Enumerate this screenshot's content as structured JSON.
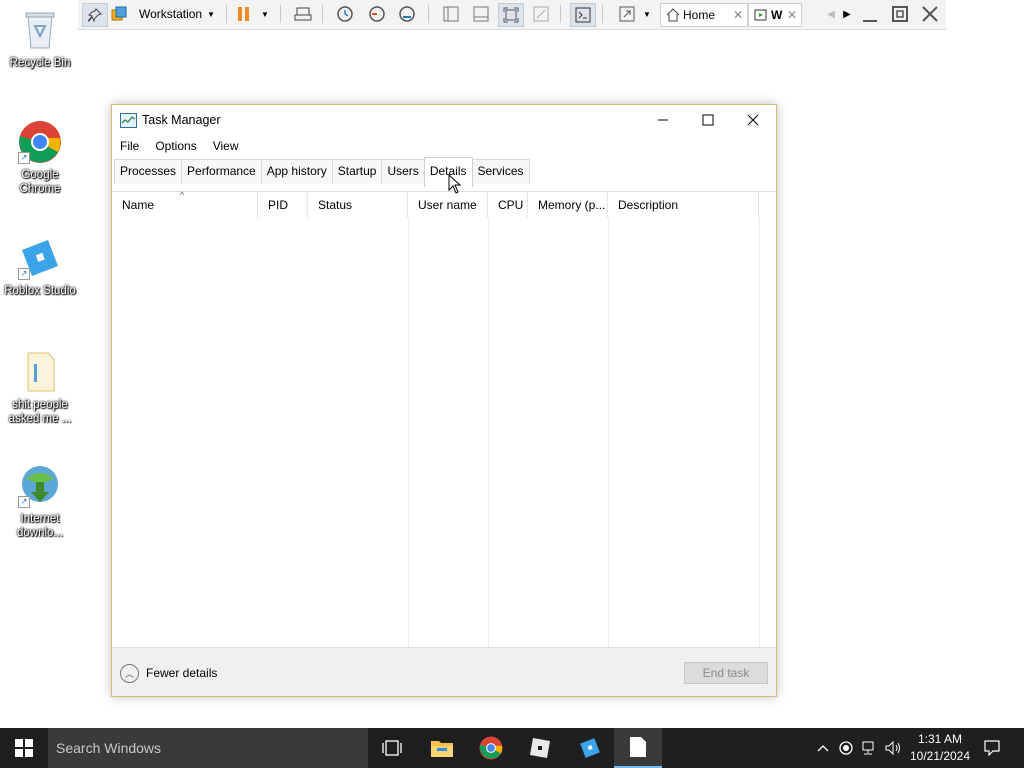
{
  "vm_toolbar": {
    "workstation_label": "Workstation",
    "tabs": [
      {
        "label": "Home"
      },
      {
        "label": "W"
      }
    ]
  },
  "desktop": {
    "icons": [
      {
        "label": "Recycle Bin"
      },
      {
        "label": "Google Chrome"
      },
      {
        "label": "Roblox Studio"
      },
      {
        "label": "shit people asked me ..."
      },
      {
        "label": "Internet downlo..."
      }
    ]
  },
  "task_manager": {
    "title": "Task Manager",
    "menu": [
      "File",
      "Options",
      "View"
    ],
    "tabs": [
      "Processes",
      "Performance",
      "App history",
      "Startup",
      "Users",
      "Details",
      "Services"
    ],
    "active_tab": "Details",
    "columns": [
      "Name",
      "PID",
      "Status",
      "User name",
      "CPU",
      "Memory (p...",
      "Description"
    ],
    "rows": [],
    "footer": {
      "fewer_details": "Fewer details",
      "end_task": "End task"
    }
  },
  "taskbar": {
    "search_placeholder": "Search Windows",
    "clock": {
      "time": "1:31 AM",
      "date": "10/21/2024"
    }
  },
  "colors": {
    "window_border": "#d9b977",
    "taskbar_bg": "#1f1f1f",
    "accent_blue": "#0078d7"
  }
}
